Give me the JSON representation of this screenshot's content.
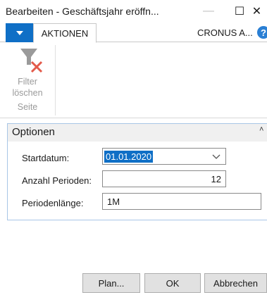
{
  "window": {
    "title": "Bearbeiten - Geschäftsjahr eröffn...",
    "minimize_glyph": "—",
    "maximize_glyph": "☐",
    "close_glyph": "✕"
  },
  "ribbon": {
    "app_menu_icon": "caret-down-icon",
    "tab_label": "AKTIONEN",
    "company": "CRONUS A...",
    "help_icon": "?",
    "filter_button": {
      "line1": "Filter",
      "line2": "löschen",
      "icon": "clear-filter-icon"
    },
    "group_label": "Seite"
  },
  "fasttab": {
    "title": "Optionen",
    "toggle_glyph": "˄",
    "fields": {
      "start_label": "Startdatum:",
      "start_value": "01.01.2020",
      "periods_label": "Anzahl Perioden:",
      "periods_value": "12",
      "length_label": "Periodenlänge:",
      "length_value": "1M"
    }
  },
  "buttons": {
    "plan": "Plan...",
    "ok": "OK",
    "cancel": "Abbrechen"
  },
  "colors": {
    "accent": "#0f6fc6",
    "fasttab_border": "#a8c6e6",
    "help": "#2a7fd4"
  }
}
